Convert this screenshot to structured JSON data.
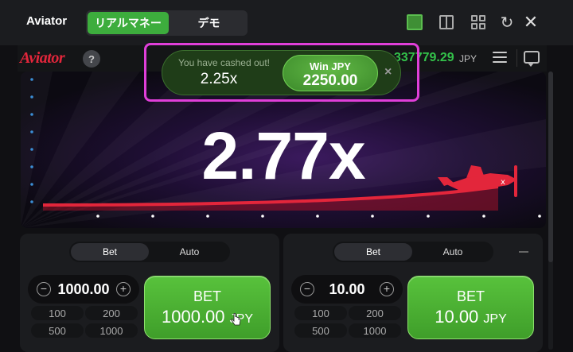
{
  "topbar": {
    "app_name": "Aviator",
    "mode_real": "リアルマネー",
    "mode_demo": "デモ",
    "icons": [
      "single-view-icon",
      "split-view-icon",
      "grid-view-icon",
      "reload-icon",
      "close-icon"
    ]
  },
  "game_header": {
    "logo": "Aviator",
    "help": "?",
    "balance": "337779.29",
    "currency": "JPY"
  },
  "game": {
    "multiplier": "2.77x",
    "accent_color": "#e3263b"
  },
  "cashout": {
    "label": "You have cashed out!",
    "multiplier": "2.25x",
    "win_title": "Win JPY",
    "win_value": "2250.00",
    "close": "×"
  },
  "panels": [
    {
      "tab_bet": "Bet",
      "tab_auto": "Auto",
      "amount": "1000.00",
      "quick": [
        "100",
        "200",
        "500",
        "1000"
      ],
      "button_label": "BET",
      "button_amount": "1000.00",
      "button_currency": "JPY"
    },
    {
      "tab_bet": "Bet",
      "tab_auto": "Auto",
      "amount": "10.00",
      "quick": [
        "100",
        "200",
        "500",
        "1000"
      ],
      "button_label": "BET",
      "button_amount": "10.00",
      "button_currency": "JPY"
    }
  ]
}
